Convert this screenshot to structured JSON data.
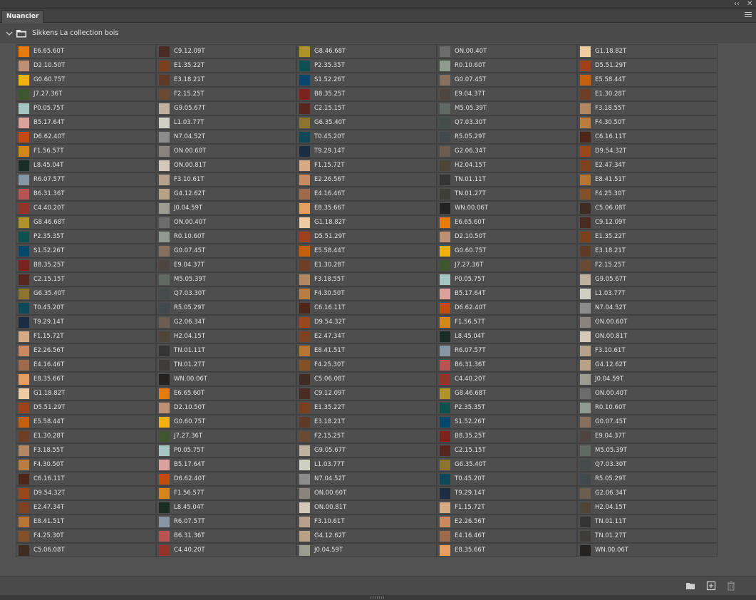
{
  "panel": {
    "tab_label": "Nuancier",
    "collapse_glyph": "‹‹",
    "close_glyph": "✕"
  },
  "group": {
    "title": "Sikkens La collection bois"
  },
  "swatches": [
    {
      "name": "E6.65.60T",
      "color": "#e57b0d"
    },
    {
      "name": "D2.10.50T",
      "color": "#bd8f75"
    },
    {
      "name": "G0.60.75T",
      "color": "#f3b110"
    },
    {
      "name": "J7.27.36T",
      "color": "#3f5631"
    },
    {
      "name": "P0.05.75T",
      "color": "#a5c6c2"
    },
    {
      "name": "B5.17.64T",
      "color": "#daa29b"
    },
    {
      "name": "D6.62.40T",
      "color": "#c24c10"
    },
    {
      "name": "F1.56.57T",
      "color": "#d58619"
    },
    {
      "name": "L8.45.04T",
      "color": "#1b2c24"
    },
    {
      "name": "R6.07.57T",
      "color": "#8896a4"
    },
    {
      "name": "B6.31.36T",
      "color": "#b85554"
    },
    {
      "name": "C4.40.20T",
      "color": "#93342a"
    },
    {
      "name": "G8.46.68T",
      "color": "#b0922b"
    },
    {
      "name": "P2.35.35T",
      "color": "#0c5050"
    },
    {
      "name": "S1.52.26T",
      "color": "#05466b"
    },
    {
      "name": "B8.35.25T",
      "color": "#7b231d"
    },
    {
      "name": "C2.15.15T",
      "color": "#56261f"
    },
    {
      "name": "G6.35.40T",
      "color": "#8b742b"
    },
    {
      "name": "T0.45.20T",
      "color": "#0d4858"
    },
    {
      "name": "T9.29.14T",
      "color": "#1a2d42"
    },
    {
      "name": "F1.15.72T",
      "color": "#d6ab84"
    },
    {
      "name": "E2.26.56T",
      "color": "#c98860"
    },
    {
      "name": "E4.16.46T",
      "color": "#9e6c4c"
    },
    {
      "name": "E8.35.66T",
      "color": "#e69e61"
    },
    {
      "name": "G1.18.82T",
      "color": "#efcba2"
    },
    {
      "name": "D5.51.29T",
      "color": "#9f4119"
    },
    {
      "name": "E5.58.44T",
      "color": "#c2600e"
    },
    {
      "name": "E1.30.28T",
      "color": "#6f3f25"
    },
    {
      "name": "F3.18.55T",
      "color": "#b18862"
    },
    {
      "name": "F4.30.50T",
      "color": "#b97d40"
    },
    {
      "name": "C6.16.11T",
      "color": "#4d2619"
    },
    {
      "name": "D9.54.32T",
      "color": "#98491b"
    },
    {
      "name": "E2.47.34T",
      "color": "#7d4320"
    },
    {
      "name": "E8.41.51T",
      "color": "#b77433"
    },
    {
      "name": "F4.25.30T",
      "color": "#825128"
    },
    {
      "name": "C5.06.08T",
      "color": "#3d2b24"
    },
    {
      "name": "C9.12.09T",
      "color": "#4a2b24"
    },
    {
      "name": "E1.35.22T",
      "color": "#7a3f1d"
    },
    {
      "name": "E3.18.21T",
      "color": "#5e3a27"
    },
    {
      "name": "F2.15.25T",
      "color": "#6a4a33"
    },
    {
      "name": "G9.05.67T",
      "color": "#bfb19f"
    },
    {
      "name": "L1.03.77T",
      "color": "#cfcfc3"
    },
    {
      "name": "N7.04.52T",
      "color": "#8c8c8c"
    },
    {
      "name": "ON.00.60T",
      "color": "#8a847e"
    },
    {
      "name": "ON.00.81T",
      "color": "#d4c8bb"
    },
    {
      "name": "F3.10.61T",
      "color": "#b5a18c"
    },
    {
      "name": "G4.12.62T",
      "color": "#b8a286"
    },
    {
      "name": "J0.04.59T",
      "color": "#9d9c91"
    },
    {
      "name": "ON.00.40T",
      "color": "#6c6c6c"
    },
    {
      "name": "R0.10.60T",
      "color": "#8f9a90"
    },
    {
      "name": "G0.07.45T",
      "color": "#876f5e"
    },
    {
      "name": "E9.04.37T",
      "color": "#4f4540"
    },
    {
      "name": "M5.05.39T",
      "color": "#5f6a62"
    },
    {
      "name": "Q7.03.30T",
      "color": "#464b4b"
    },
    {
      "name": "R5.05.29T",
      "color": "#42494d"
    },
    {
      "name": "G2.06.34T",
      "color": "#6b5e51"
    },
    {
      "name": "H2.04.15T",
      "color": "#4e4438"
    },
    {
      "name": "TN.01.11T",
      "color": "#353535"
    },
    {
      "name": "TN.01.27T",
      "color": "#3f3d37"
    },
    {
      "name": "WN.00.06T",
      "color": "#242321"
    }
  ],
  "bottom": {
    "folder_icon": "new-group-icon",
    "add_icon": "new-swatch-icon",
    "delete_icon": "trash-icon"
  }
}
